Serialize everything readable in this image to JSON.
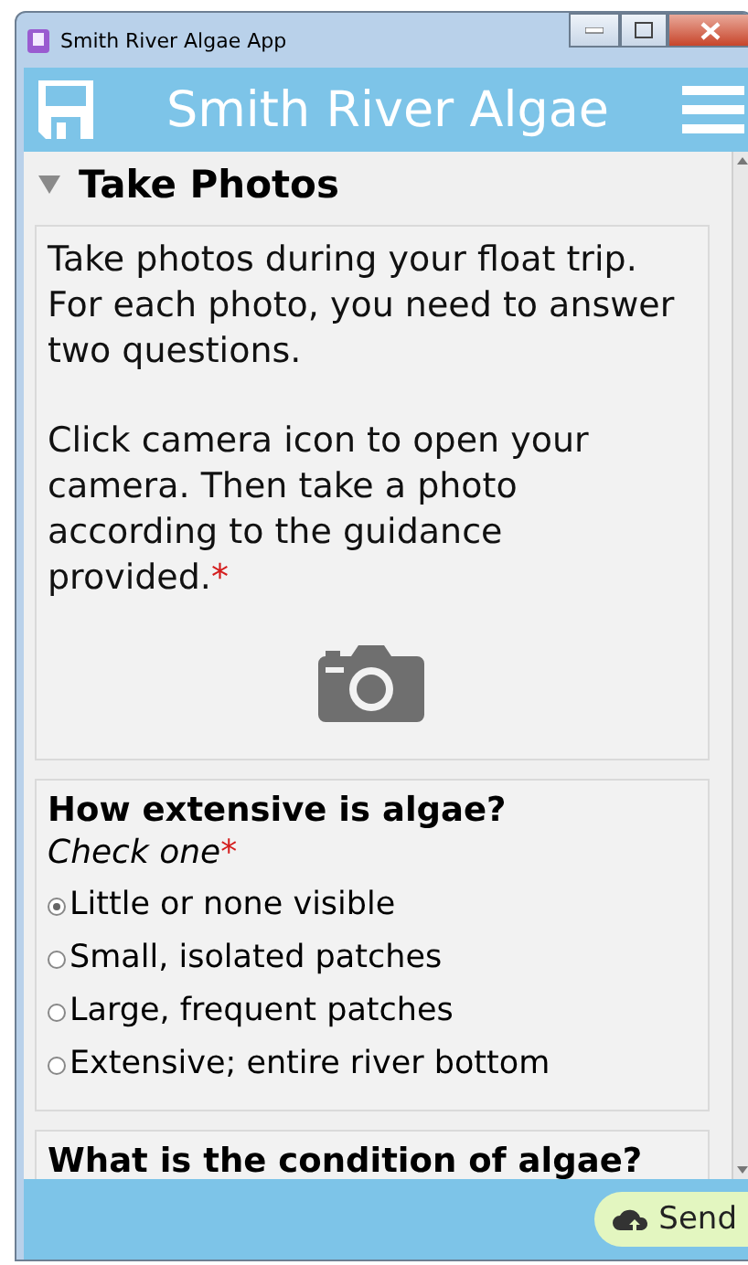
{
  "window": {
    "title": "Smith River Algae App"
  },
  "header": {
    "title": "Smith River Algae"
  },
  "section": {
    "title": "Take Photos",
    "expanded": true
  },
  "instructions": {
    "paragraphs": [
      "Take photos during your float trip. For each photo, you need to answer two questions.",
      "Click camera icon to open your camera. Then take a photo according to the guidance provided."
    ],
    "required_mark": "*"
  },
  "questions": [
    {
      "title": "How extensive is algae?",
      "hint": "Check one",
      "required_mark": "*",
      "options": [
        {
          "label": "Little or none visible",
          "selected": true
        },
        {
          "label": "Small, isolated patches",
          "selected": false
        },
        {
          "label": "Large, frequent patches",
          "selected": false
        },
        {
          "label": "Extensive; entire river bottom",
          "selected": false
        }
      ]
    },
    {
      "title": "What is the condition of algae?"
    }
  ],
  "footer": {
    "send_button": "Send"
  }
}
